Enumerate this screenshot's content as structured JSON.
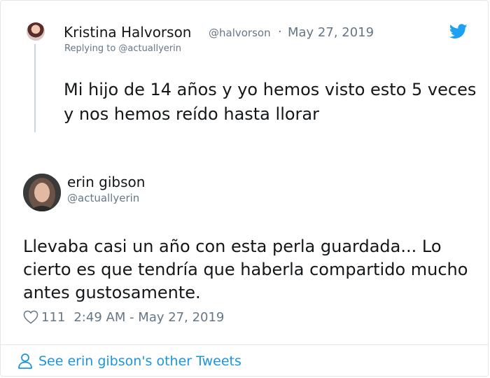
{
  "parent_tweet": {
    "avatar_icon": "user-avatar-icon",
    "name": "Kristina Halvorson",
    "handle": "@halvorson",
    "separator": "·",
    "date": "May 27, 2019",
    "replying_to": "Replying to @actuallyerin",
    "text": "Mi hijo de 14 años y yo hemos visto esto 5 veces y nos hemos reído hasta llorar"
  },
  "main_tweet": {
    "avatar_icon": "user-avatar-icon",
    "name": "erin gibson",
    "handle": "@actuallyerin",
    "text": "Llevaba casi un año con esta perla guardada... Lo cierto es que tendría que haberla compartido mucho antes gustosamente.",
    "likes": "111",
    "timestamp": "2:49 AM - May 27, 2019"
  },
  "footer": {
    "icon": "person-icon",
    "link_text": "See erin gibson's other Tweets"
  },
  "colors": {
    "twitter_blue": "#1da1f2",
    "link_blue": "#1b95e0",
    "secondary_text": "#657786",
    "border": "#e1e8ed"
  }
}
